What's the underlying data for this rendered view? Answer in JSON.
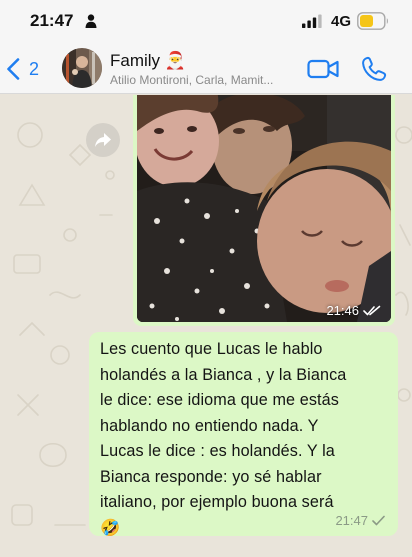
{
  "status_bar": {
    "time": "21:47",
    "network": "4G",
    "person_icon": "person-icon",
    "signal_icon": "cellular-signal-icon",
    "battery_icon": "battery-icon",
    "battery_color": "#f5c518"
  },
  "header": {
    "back_count": "2",
    "title": "Family 🎅",
    "subtitle": "Atilio Montironi, Carla, Mamit...",
    "back_icon": "chevron-left-icon",
    "video_icon": "video-camera-icon",
    "call_icon": "phone-icon",
    "accent_color": "#1f7ef0"
  },
  "messages": [
    {
      "type": "photo",
      "time": "21:46",
      "status_icon": "double-check-icon"
    },
    {
      "type": "text",
      "lines": [
        "Les cuento que Lucas le hablo",
        "holandés a la Bianca , y la Bianca",
        "le dice: ese idioma que me estás",
        "hablando no entiendo nada. Y",
        "Lucas le dice : es holandés. Y la",
        "Bianca responde: yo sé hablar",
        "italiano, por ejemplo buona será"
      ],
      "emoji": "🤣",
      "time": "21:47",
      "status_icon": "single-check-icon"
    }
  ],
  "colors": {
    "outgoing_bubble": "#dcf8c6",
    "chat_background": "#e9e4da"
  }
}
